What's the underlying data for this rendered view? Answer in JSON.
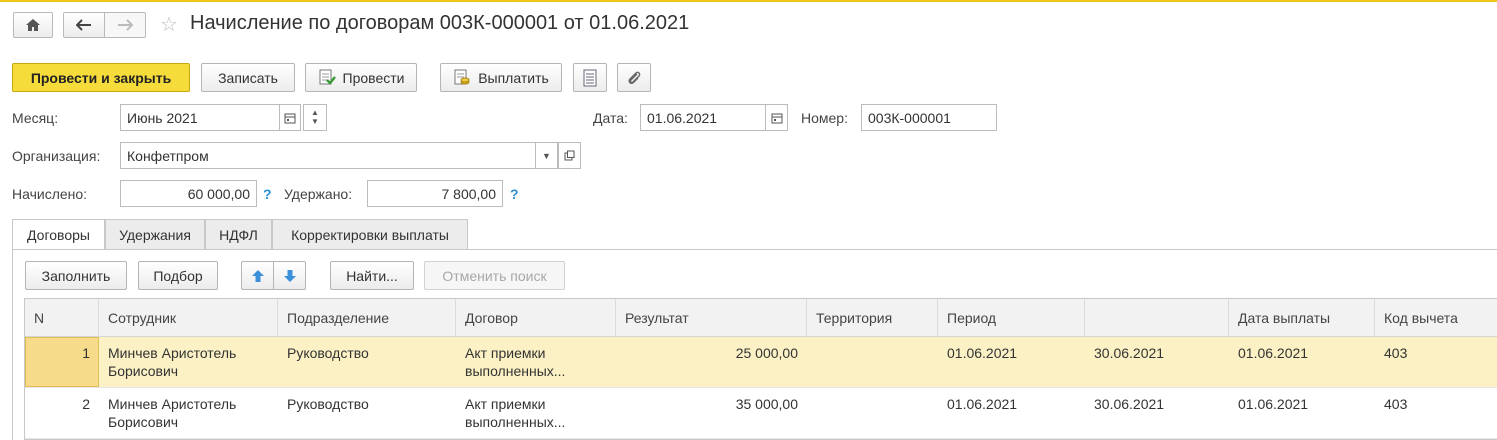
{
  "window": {
    "title": "Начисление по договорам 003К-000001 от 01.06.2021"
  },
  "toolbar": {
    "post_and_close": "Провести и закрыть",
    "save": "Записать",
    "post": "Провести",
    "pay": "Выплатить"
  },
  "form": {
    "month_label": "Месяц:",
    "month_value": "Июнь 2021",
    "date_label": "Дата:",
    "date_value": "01.06.2021",
    "number_label": "Номер:",
    "number_value": "003К-000001",
    "org_label": "Организация:",
    "org_value": "Конфетпром",
    "accrued_label": "Начислено:",
    "accrued_value": "60 000,00",
    "withheld_label": "Удержано:",
    "withheld_value": "7 800,00",
    "help": "?"
  },
  "tabs": [
    {
      "label": "Договоры",
      "active": true
    },
    {
      "label": "Удержания",
      "active": false
    },
    {
      "label": "НДФЛ",
      "active": false
    },
    {
      "label": "Корректировки выплаты",
      "active": false
    }
  ],
  "table_toolbar": {
    "fill": "Заполнить",
    "select": "Подбор",
    "find": "Найти...",
    "cancel_search": "Отменить поиск"
  },
  "table": {
    "columns": [
      "N",
      "Сотрудник",
      "Подразделение",
      "Договор",
      "Результат",
      "Территория",
      "Период",
      "",
      "Дата выплаты",
      "Код вычета"
    ],
    "rows": [
      {
        "n": "1",
        "employee_1": "Минчев Аристотель",
        "employee_2": "Борисович",
        "department": "Руководство",
        "contract_1": "Акт приемки",
        "contract_2": "выполненных...",
        "result": "25 000,00",
        "territory": "",
        "period_from": "01.06.2021",
        "period_to": "30.06.2021",
        "pay_date": "01.06.2021",
        "deduction_code": "403",
        "selected": true
      },
      {
        "n": "2",
        "employee_1": "Минчев Аристотель",
        "employee_2": "Борисович",
        "department": "Руководство",
        "contract_1": "Акт приемки",
        "contract_2": "выполненных...",
        "result": "35 000,00",
        "territory": "",
        "period_from": "01.06.2021",
        "period_to": "30.06.2021",
        "pay_date": "01.06.2021",
        "deduction_code": "403",
        "selected": false
      }
    ]
  },
  "colors": {
    "accent_yellow": "#f6dc3b",
    "selected_row": "#fbf1c4",
    "help_blue": "#2a8fd6",
    "arrow_blue": "#3c8fd9"
  }
}
